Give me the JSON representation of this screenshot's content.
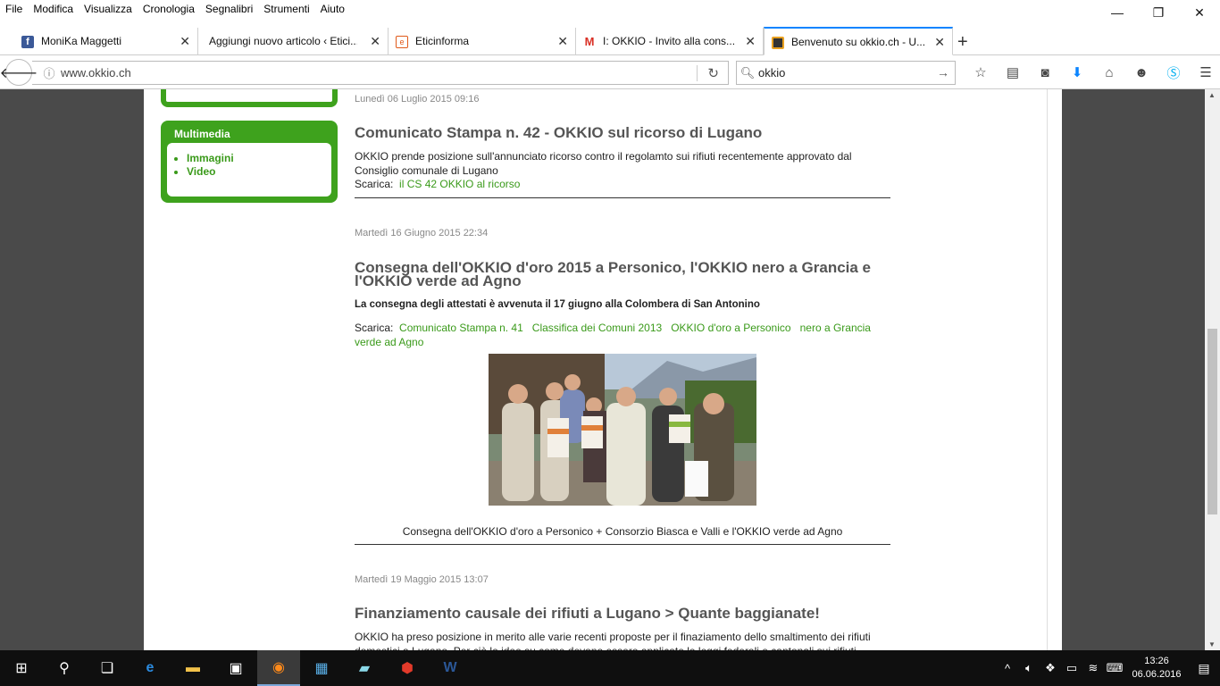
{
  "menu": [
    "File",
    "Modifica",
    "Visualizza",
    "Cronologia",
    "Segnalibri",
    "Strumenti",
    "Aiuto"
  ],
  "window_controls": {
    "minimize": "—",
    "restore": "❐",
    "close": "✕"
  },
  "tabs": [
    {
      "label": "MoniKa Maggetti",
      "icon": "facebook-icon",
      "color": "#3b5998"
    },
    {
      "label": "Aggiungi nuovo articolo ‹ Etici...",
      "icon": "page-icon",
      "color": "#dddddd"
    },
    {
      "label": "Eticinforma",
      "icon": "eticinforma-icon",
      "color": "#e05a1a"
    },
    {
      "label": "I: OKKIO - Invito alla cons...",
      "icon": "gmail-icon",
      "color": "#d93025"
    },
    {
      "label": "Benvenuto su okkio.ch - U...",
      "icon": "okkio-icon",
      "color": "#444444"
    }
  ],
  "address": {
    "url": "www.okkio.ch"
  },
  "search": {
    "value": "okkio"
  },
  "sidebar": {
    "multimedia_title": "Multimedia",
    "items": [
      "Immagini",
      "Video"
    ]
  },
  "articles": [
    {
      "date": "Lunedì 06 Luglio 2015 09:16",
      "title": "Comunicato Stampa n. 42 - OKKIO sul ricorso di Lugano",
      "body": "OKKIO prende posizione sull'annunciato ricorso contro il regolamto sui rifiuti recentemente approvato dal Consiglio comunale di Lugano",
      "download_label": "Scarica:",
      "links": [
        "il CS 42 OKKIO al ricorso"
      ]
    },
    {
      "date": "Martedì 16 Giugno 2015 22:34",
      "title": "Consegna dell'OKKIO d'oro 2015 a Personico, l'OKKIO  nero a Grancia e l'OKKIO verde ad Agno",
      "subtitle": "La consegna degli attestati è avvenuta il 17 giugno alla Colombera di San Antonino",
      "download_label": "Scarica:",
      "links": [
        "Comunicato Stampa n. 41",
        "Classifica dei Comuni 2013",
        "OKKIO d'oro a Personico",
        "nero a Grancia verde ad Agno"
      ],
      "caption": "Consegna dell'OKKIO d'oro a Personico + Consorzio Biasca e Valli e l'OKKIO verde ad Agno"
    },
    {
      "date": "Martedì 19 Maggio 2015 13:07",
      "title": "Finanziamento causale dei rifiuti a Lugano >  Quante baggianate!",
      "body": "OKKIO ha preso posizione in merito alle varie recenti proposte per il finaziamento dello smaltimento dei rifiuti domestici a Lugano. Per ciò le idee su come devono essere applicate le leggi federali e cantonali sui rifiuti"
    }
  ],
  "taskbar": {
    "time": "13:26",
    "date": "06.06.2016"
  }
}
